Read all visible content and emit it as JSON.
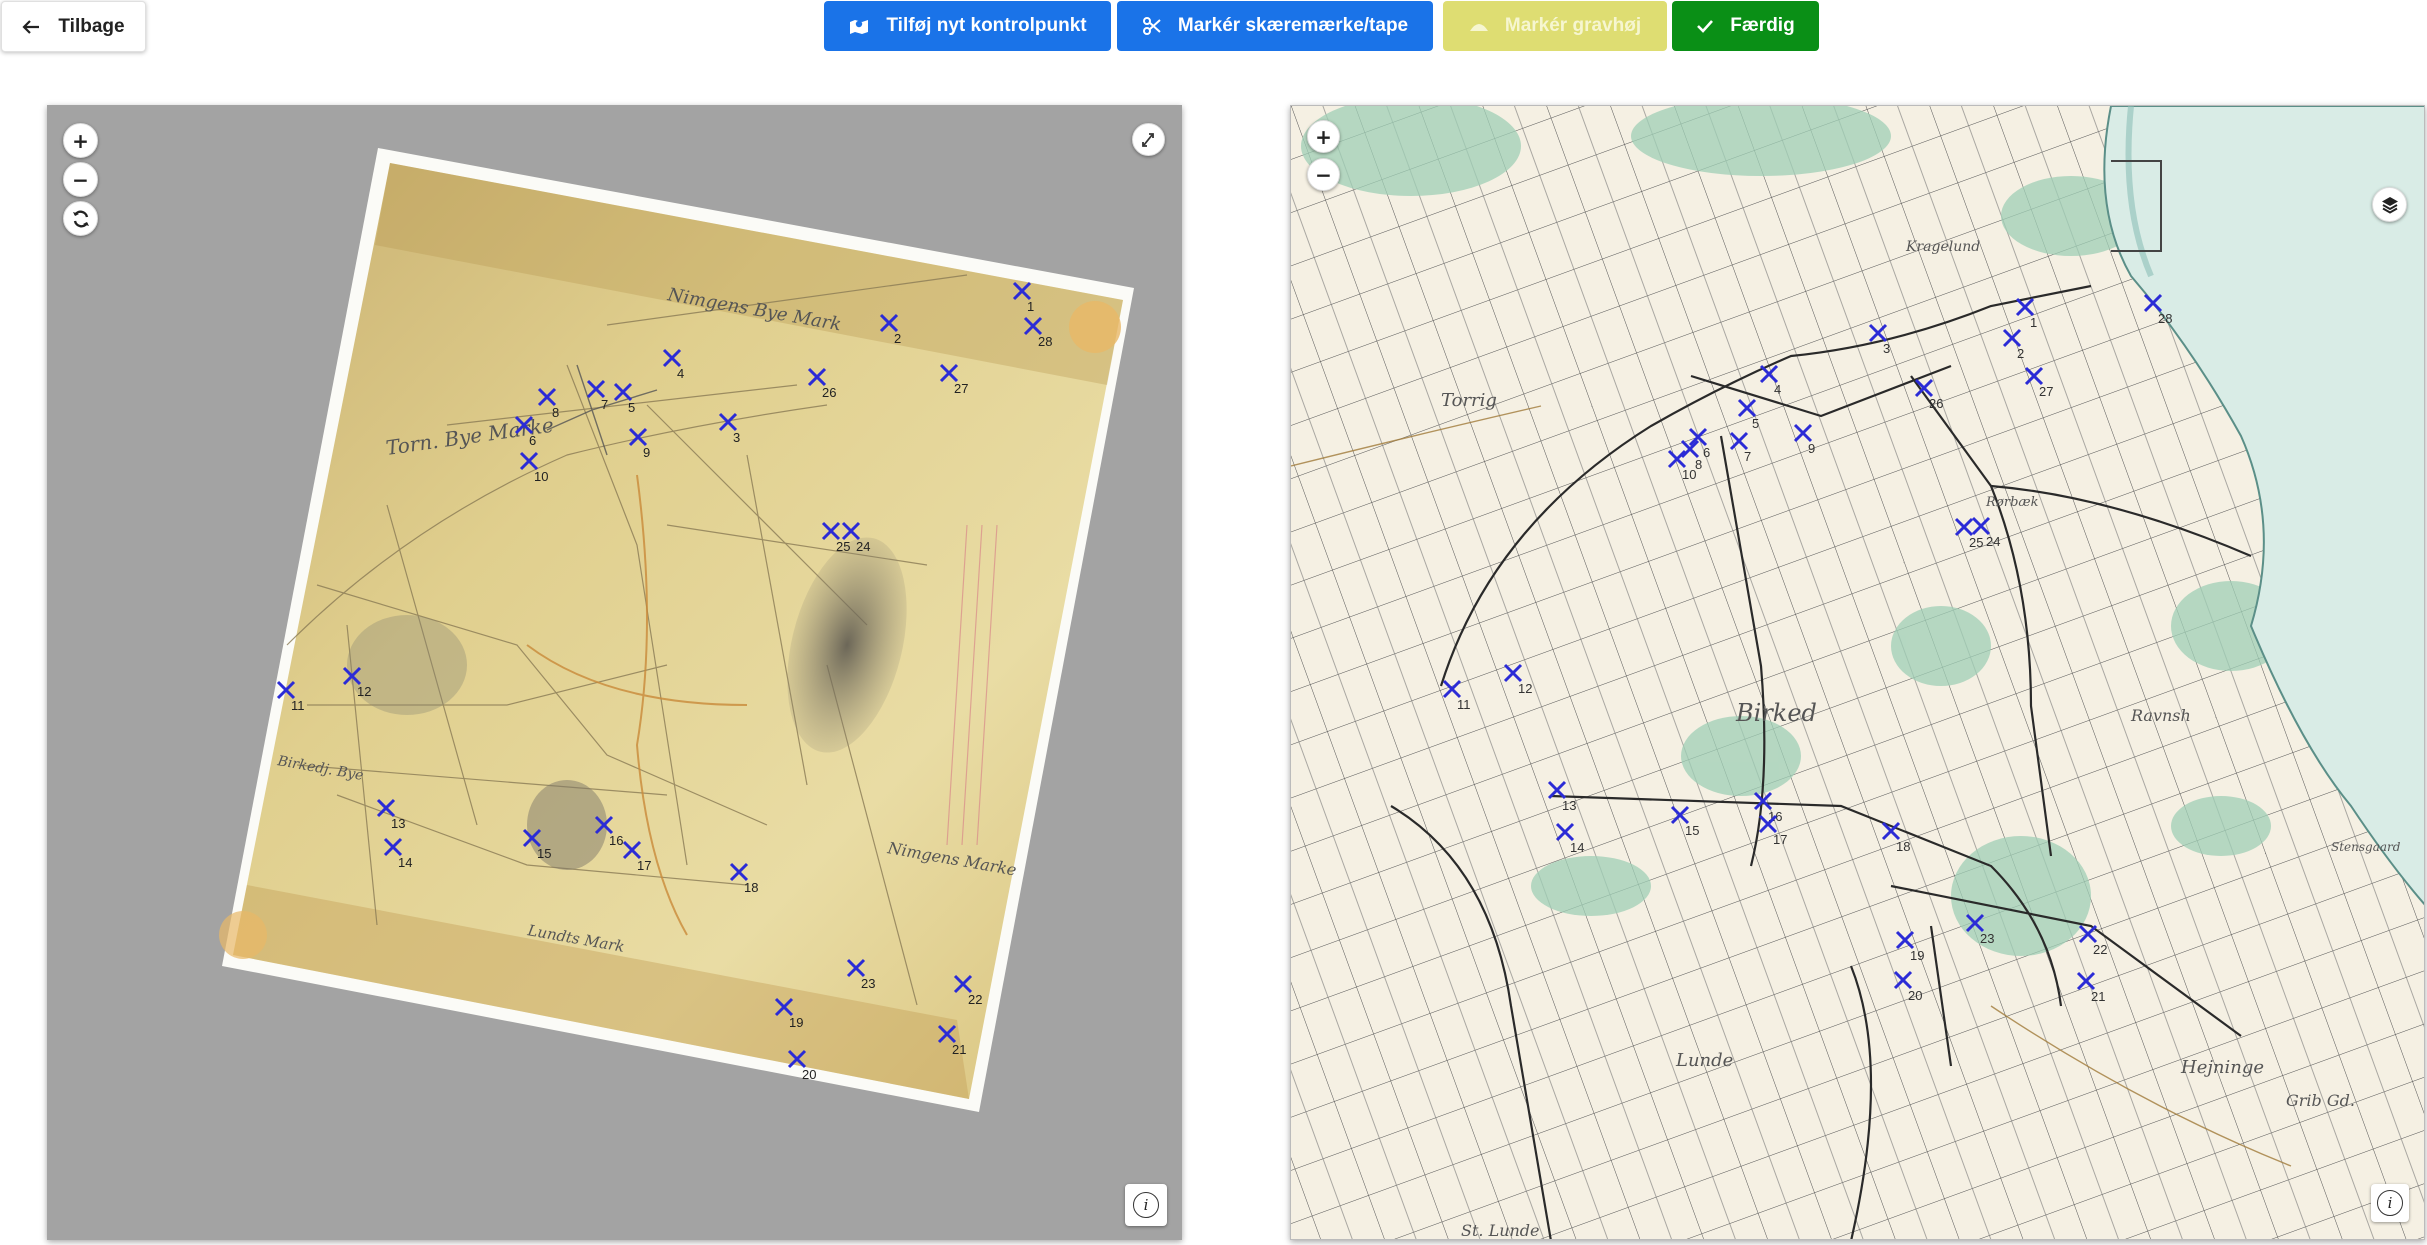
{
  "toolbar": {
    "back_label": "Tilbage",
    "add_control_point_label": "Tilføj nyt kontrolpunkt",
    "mark_cut_label": "Markér skæremærke/tape",
    "mark_mound_label": "Markér gravhøj",
    "done_label": "Færdig"
  },
  "colors": {
    "primary": "#1a73e8",
    "disabled_yellow": "#dedd72",
    "success": "#0a8f16",
    "marker": "#2b2bd6"
  },
  "left_map": {
    "zoom_in": "+",
    "zoom_out": "−",
    "reset_icon": "refresh-icon",
    "rotate_icon": "rotate-handle-icon",
    "info": "i",
    "sheet_texts": [
      "Nimgens Bye Mark",
      "Torn. Bye Marke",
      "Birkedj. Bye",
      "Nimgens Marke",
      "Lundts Mark"
    ]
  },
  "right_map": {
    "zoom_in": "+",
    "zoom_out": "−",
    "layers_icon": "layers-icon",
    "info": "i",
    "place_names": [
      "Torrig",
      "Birked",
      "Kragelund",
      "Rørbæk",
      "Ravnsh",
      "Hejninge",
      "St. Lunde",
      "Lunde",
      "Stensgaard",
      "Grib Gd."
    ]
  },
  "control_points_left": [
    "1",
    "2",
    "3",
    "4",
    "5",
    "6",
    "7",
    "8",
    "9",
    "10",
    "11",
    "12",
    "13",
    "14",
    "15",
    "16",
    "17",
    "18",
    "19",
    "20",
    "21",
    "22",
    "23",
    "24",
    "25",
    "26",
    "27",
    "28"
  ],
  "control_points_right": [
    "1",
    "2",
    "3",
    "4",
    "5",
    "6",
    "7",
    "8",
    "9",
    "10",
    "11",
    "12",
    "13",
    "14",
    "15",
    "16",
    "17",
    "18",
    "19",
    "20",
    "21",
    "22",
    "23",
    "24",
    "25",
    "26",
    "27",
    "28"
  ]
}
